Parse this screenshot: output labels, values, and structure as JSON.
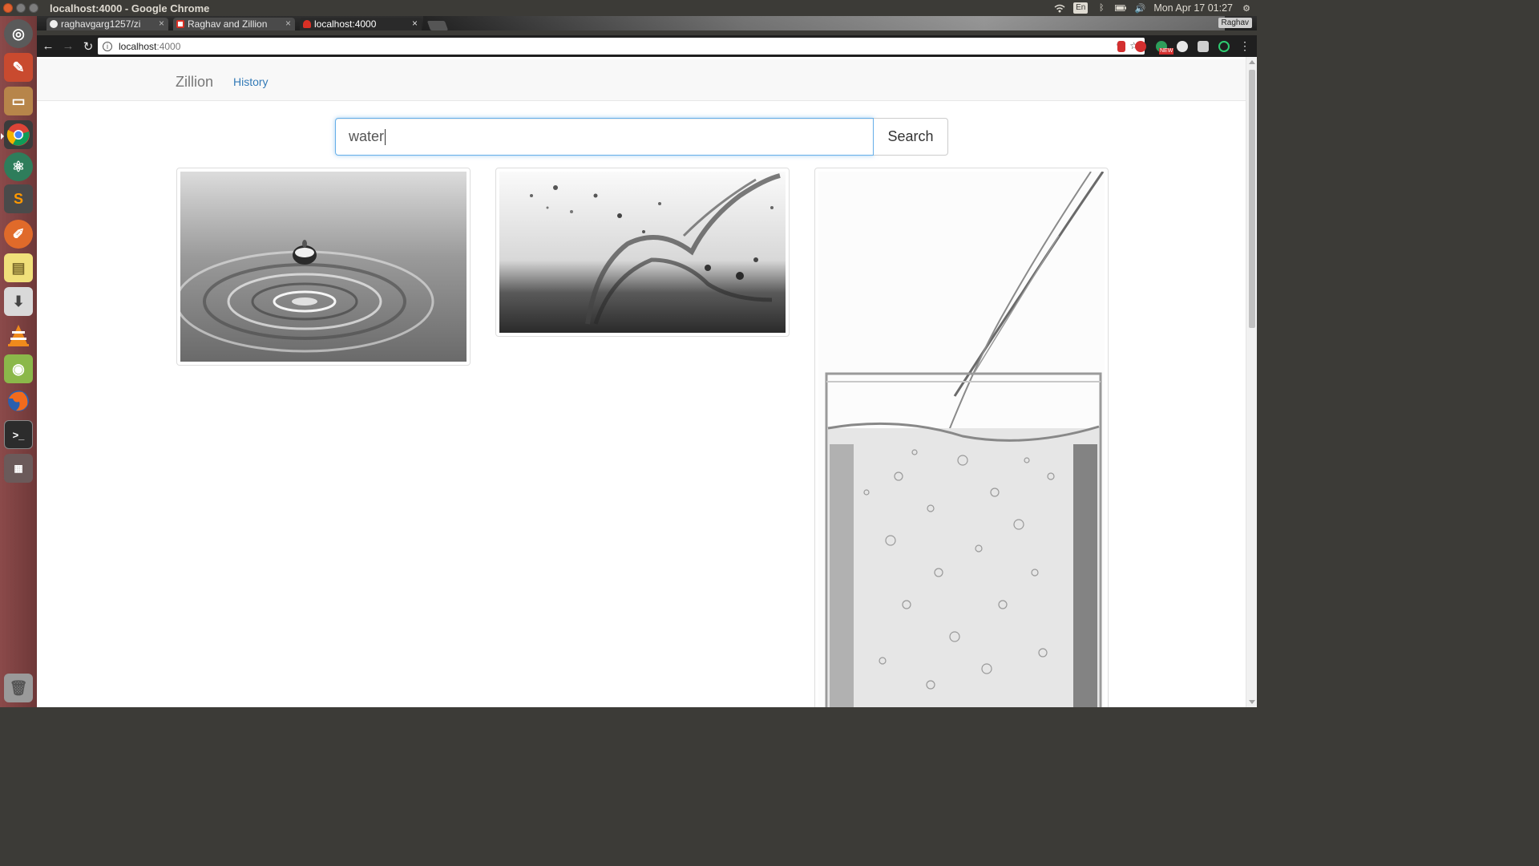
{
  "os": {
    "window_title": "localhost:4000 - Google Chrome",
    "keyboard_layout": "En",
    "clock": "Mon Apr 17 01:27"
  },
  "browser": {
    "profile_name": "Raghav",
    "tabs": [
      {
        "label": "raghavgarg1257/zi",
        "favicon": "github-icon",
        "active": false
      },
      {
        "label": "Raghav and Zillion",
        "favicon": "gmail-icon",
        "active": false
      },
      {
        "label": "localhost:4000",
        "favicon": "app-favicon",
        "active": true
      }
    ],
    "url_host": "localhost",
    "url_port": ":4000",
    "ext_badge": "NEW"
  },
  "app": {
    "brand": "Zillion",
    "nav_history": "History",
    "search_value": "water",
    "search_button": "Search"
  },
  "results": [
    {
      "name": "water-droplet-ripple-image"
    },
    {
      "name": "water-splash-image"
    },
    {
      "name": "water-pouring-glass-image"
    }
  ],
  "colors": {
    "link": "#337ab7",
    "focus_border": "#66afe9",
    "launcher": "#7a4040"
  }
}
